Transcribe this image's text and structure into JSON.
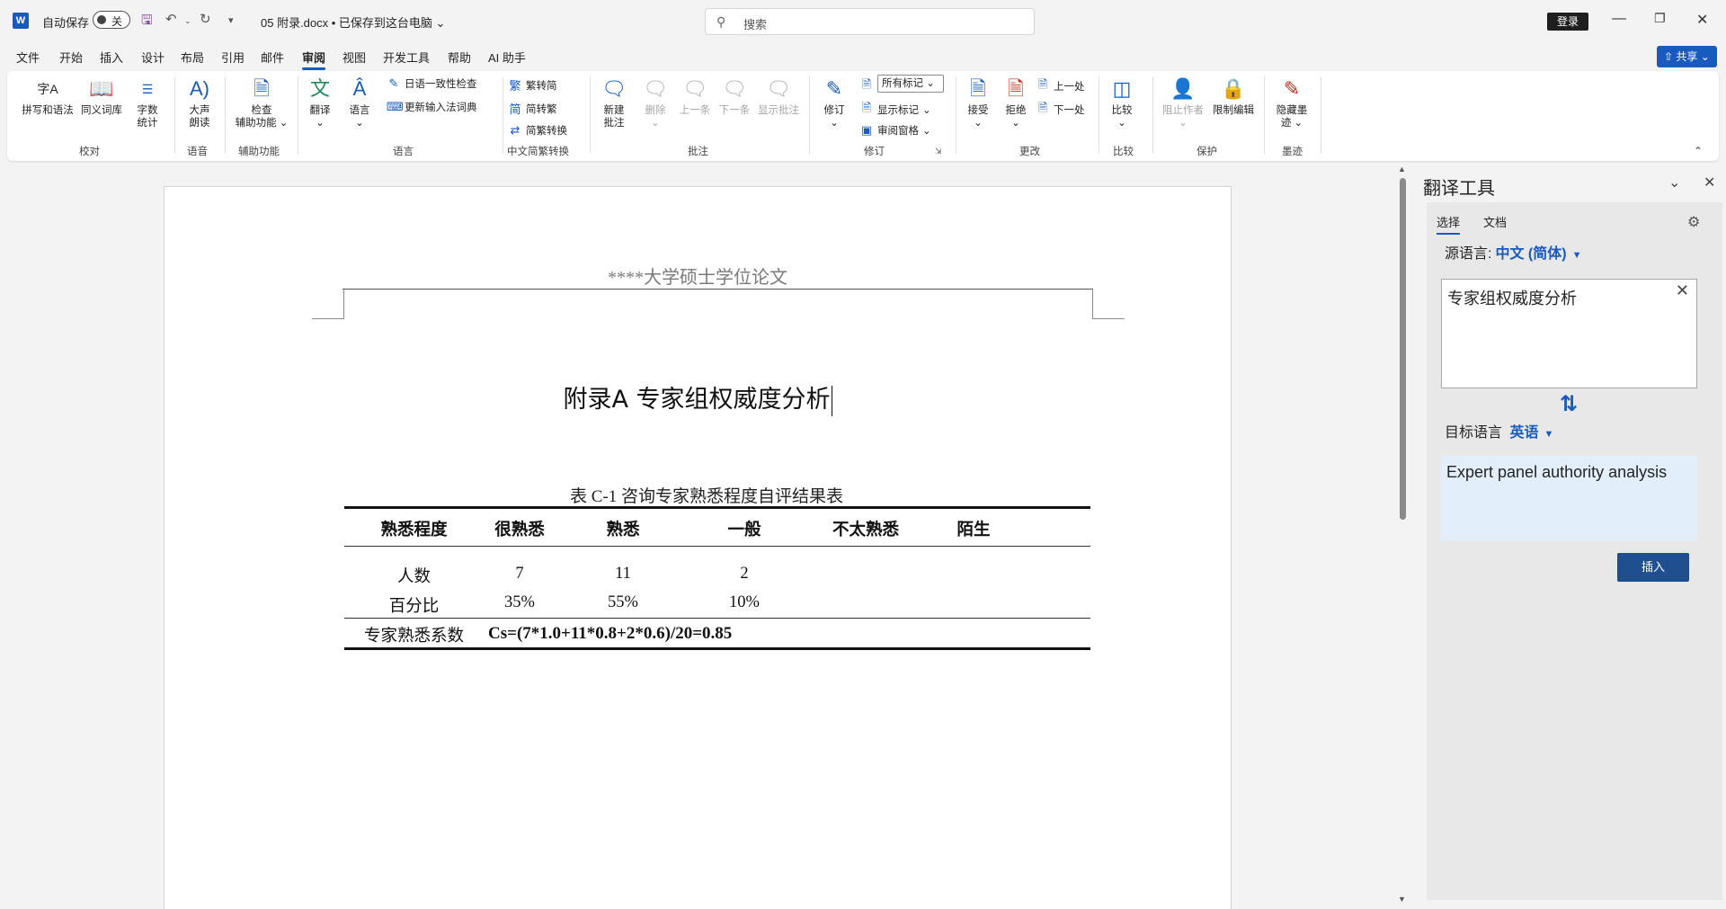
{
  "titlebar": {
    "app_icon": "W",
    "autosave_label": "自动保存",
    "autosave_state": "关",
    "doc_title": "05 附录.docx • 已保存到这台电脑",
    "title_dropdown": "⌄",
    "search_placeholder": "搜索",
    "login": "登录",
    "icons": {
      "save": "save-icon",
      "undo": "undo-icon",
      "redo": "redo-icon",
      "customize": "customize-icon"
    }
  },
  "menu": {
    "items": [
      "文件",
      "开始",
      "插入",
      "设计",
      "布局",
      "引用",
      "邮件",
      "审阅",
      "视图",
      "开发工具",
      "帮助",
      "AI 助手"
    ],
    "active_index": 7,
    "share": "共享"
  },
  "ribbon": {
    "proofing": {
      "spelling": "拼写和语法",
      "thesaurus": "同义词库",
      "wordcount_1": "字数",
      "wordcount_2": "统计",
      "group": "校对"
    },
    "speech": {
      "read_aloud_1": "大声",
      "read_aloud_2": "朗读",
      "group": "语音"
    },
    "accessibility": {
      "check_1": "检查",
      "check_2": "辅助功能",
      "group": "辅助功能"
    },
    "language": {
      "translate": "翻译",
      "language": "语言",
      "jp_check": "日语一致性检查",
      "ime_dict": "更新输入法词典",
      "group": "语言"
    },
    "chinese_conv": {
      "to_simplified": "繁转简",
      "to_traditional": "简转繁",
      "conversion": "简繁转换",
      "group": "中文简繁转换"
    },
    "comments": {
      "new_1": "新建",
      "new_2": "批注",
      "delete": "删除",
      "prev": "上一条",
      "next": "下一条",
      "show": "显示批注",
      "group": "批注"
    },
    "tracking": {
      "track": "修订",
      "markup_dropdown": "所有标记",
      "show_markup": "显示标记",
      "review_pane": "审阅窗格",
      "group": "修订"
    },
    "changes": {
      "accept": "接受",
      "reject": "拒绝",
      "prev": "上一处",
      "next": "下一处",
      "group": "更改"
    },
    "compare": {
      "compare": "比较",
      "group": "比较"
    },
    "protect": {
      "block_authors": "阻止作者",
      "restrict": "限制编辑",
      "group": "保护"
    },
    "ink": {
      "hide_1": "隐藏墨",
      "hide_2": "迹",
      "group": "墨迹"
    }
  },
  "document": {
    "header": "****大学硕士学位论文",
    "heading": "附录A 专家组权威度分析",
    "caption": "表  C-1  咨询专家熟悉程度自评结果表",
    "table": {
      "headers": [
        "熟悉程度",
        "很熟悉",
        "熟悉",
        "一般",
        "不太熟悉",
        "陌生"
      ],
      "row_count": [
        "人数",
        "7",
        "11",
        "2",
        "",
        ""
      ],
      "row_percent": [
        "百分比",
        "35%",
        "55%",
        "10%",
        "",
        ""
      ],
      "coef_label": "专家熟悉系数",
      "formula": "Cs=(7*1.0+11*0.8+2*0.6)/20=0.85"
    }
  },
  "translator": {
    "title": "翻译工具",
    "tabs": [
      "选择",
      "文档"
    ],
    "source_label": "源语言:",
    "source_lang": "中文 (简体)",
    "source_text": "专家组权威度分析",
    "target_label": "目标语言",
    "target_lang": "英语",
    "target_text": "Expert panel authority analysis",
    "insert": "插入"
  },
  "colors": {
    "accent": "#185abd",
    "insert_button": "#1f4f8f",
    "target_box": "#e3eefb"
  }
}
